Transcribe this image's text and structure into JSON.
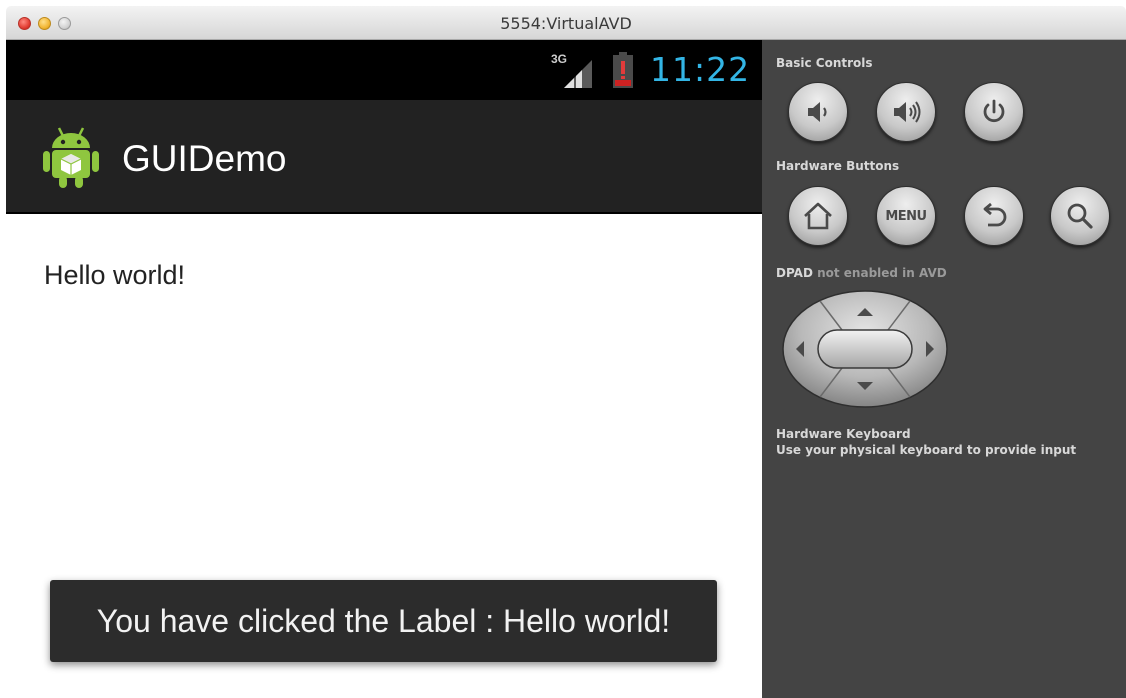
{
  "window": {
    "title": "5554:VirtualAVD"
  },
  "status_bar": {
    "network": "3G",
    "clock": "11:22",
    "clock_color": "#33b5e5",
    "battery_state": "low"
  },
  "action_bar": {
    "app_icon": "android-robot-icon",
    "title": "GUIDemo"
  },
  "content": {
    "text": "Hello world!"
  },
  "toast": {
    "message": "You have clicked the Label : Hello world!"
  },
  "controls": {
    "basic_label": "Basic Controls",
    "basic_buttons": [
      "volume-down-icon",
      "volume-up-icon",
      "power-icon"
    ],
    "hardware_label": "Hardware Buttons",
    "hardware_buttons": [
      "home-icon",
      "menu-button",
      "back-icon",
      "search-icon"
    ],
    "menu_label": "MENU",
    "dpad_label_strong": "DPAD",
    "dpad_label_rest": "not enabled in AVD",
    "keyboard_label": "Hardware Keyboard",
    "keyboard_hint": "Use your physical keyboard to provide input"
  }
}
